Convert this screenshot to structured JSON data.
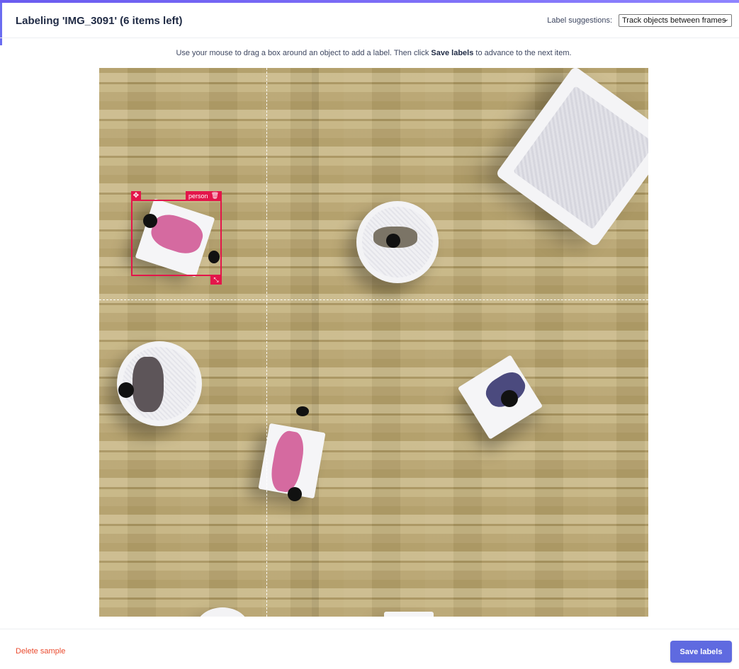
{
  "header": {
    "title": "Labeling 'IMG_3091' (6 items left)",
    "suggestions_label": "Label suggestions:",
    "suggestions_value": "Track objects between frames"
  },
  "instructions": {
    "before": "Use your mouse to drag a box around an object to add a label. Then click ",
    "bold": "Save labels",
    "after": " to advance to the next item."
  },
  "annotations": [
    {
      "label": "person"
    }
  ],
  "footer": {
    "delete_label": "Delete sample",
    "save_label": "Save labels"
  },
  "colors": {
    "accent": "#5f6ae0",
    "bbox": "#e3164a",
    "delete": "#ea4b2f"
  }
}
